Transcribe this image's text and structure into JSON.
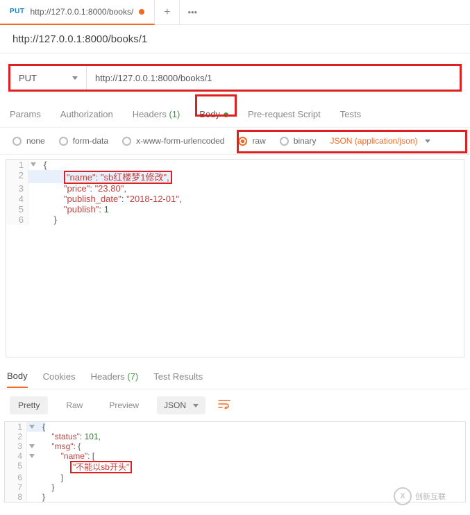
{
  "tabs": {
    "method": "PUT",
    "title": "http://127.0.0.1:8000/books/",
    "plus": "+",
    "more": "•••"
  },
  "url_label": "http://127.0.0.1:8000/books/1",
  "request": {
    "method": "PUT",
    "url": "http://127.0.0.1:8000/books/1"
  },
  "req_tabs": {
    "params": "Params",
    "auth": "Authorization",
    "headers": "Headers",
    "headers_count": "(1)",
    "body": "Body",
    "prescript": "Pre-request Script",
    "tests": "Tests"
  },
  "body_opts": {
    "none": "none",
    "formdata": "form-data",
    "xwww": "x-www-form-urlencoded",
    "raw": "raw",
    "binary": "binary",
    "content_type": "JSON (application/json)"
  },
  "request_body": {
    "l1": "{",
    "l2_key": "\"name\"",
    "l2_val": "\"sb红楼梦1修改\"",
    "l3_key": "\"price\"",
    "l3_val": "\"23.80\"",
    "l4_key": "\"publish_date\"",
    "l4_val": "\"2018-12-01\"",
    "l5_key": "\"publish\"",
    "l5_val": "1",
    "l6": "}"
  },
  "resp_tabs": {
    "body": "Body",
    "cookies": "Cookies",
    "headers": "Headers",
    "headers_count": "(7)",
    "tests": "Test Results"
  },
  "resp_controls": {
    "pretty": "Pretty",
    "raw": "Raw",
    "preview": "Preview",
    "format": "JSON",
    "wrap": "⟲"
  },
  "response_body": {
    "l1": "{",
    "l2_key": "\"status\"",
    "l2_val": "101",
    "l3_key": "\"msg\"",
    "l4_key": "\"name\"",
    "l5_val": "\"不能以sb开头\"",
    "l6": "]",
    "l7": "}",
    "l8": "}"
  },
  "logo": "创新互联"
}
